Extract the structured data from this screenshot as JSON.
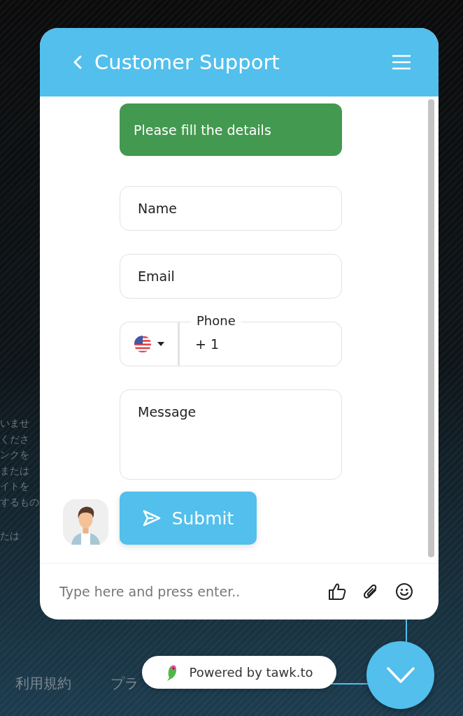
{
  "background": {
    "paragraphs": [
      [
        "いませ",
        "くださ",
        "ンクを",
        "または",
        "イトを",
        "するもの"
      ],
      [
        "たは"
      ]
    ],
    "footer_links": [
      "利用規約",
      "プラ"
    ]
  },
  "widget": {
    "header": {
      "title": "Customer Support"
    },
    "banner": "Please fill the details",
    "fields": [
      {
        "kind": "text",
        "placeholder": "Name"
      },
      {
        "kind": "text",
        "placeholder": "Email"
      },
      {
        "kind": "phone",
        "label": "Phone",
        "value": "+ 1"
      },
      {
        "kind": "textarea",
        "placeholder": "Message"
      }
    ],
    "submit": "Submit",
    "composer": {
      "placeholder": "Type here and press enter.."
    }
  },
  "powered_by": "Powered by tawk.to"
}
